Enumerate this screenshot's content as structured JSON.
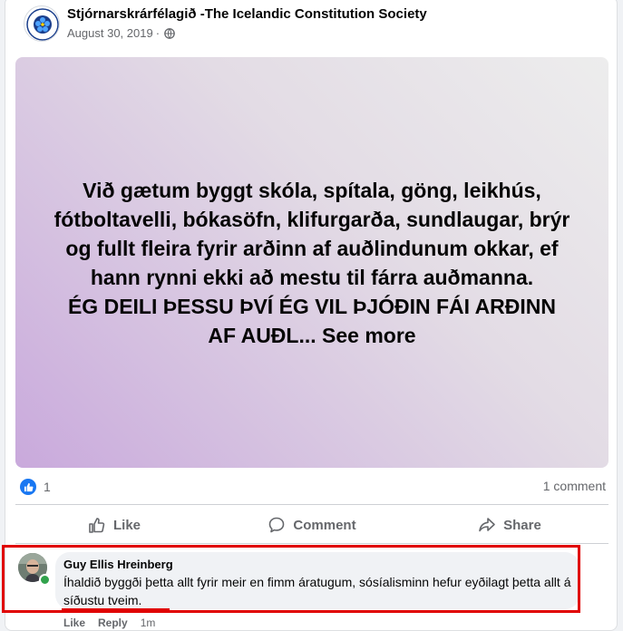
{
  "post": {
    "page_name": "Stjórnarskrárfélagið -The Icelandic Constitution Society",
    "date": "August 30, 2019",
    "date_separator": "·",
    "privacy_icon": "globe-icon",
    "image_text_line1": "Við gætum byggt skóla, spítala, göng, leikhús,",
    "image_text_line2": "fótboltavelli, bókasöfn, klifurgarða, sundlaugar, brýr",
    "image_text_line3": "og fullt fleira fyrir arðinn af auðlindunum okkar, ef",
    "image_text_line4": "hann rynni ekki að mestu til fárra auðmanna.",
    "image_text_line5": "ÉG DEILI ÞESSU ÞVÍ ÉG VIL ÞJÓÐIN FÁI ARÐINN",
    "image_text_line6": "AF AUÐL... See more"
  },
  "stats": {
    "reaction_count": "1",
    "comment_count": "1 comment"
  },
  "actions": {
    "like": "Like",
    "comment": "Comment",
    "share": "Share"
  },
  "comment": {
    "author": "Guy Ellis Hreinberg",
    "text": "Íhaldið byggði þetta allt fyrir meir en fimm áratugum, sósíalisminn hefur eyðilagt þetta allt á síðustu tveim.",
    "like": "Like",
    "reply": "Reply",
    "time": "1m"
  },
  "colors": {
    "accent": "#1877f2",
    "highlight": "#e00000",
    "online": "#31a24c"
  }
}
